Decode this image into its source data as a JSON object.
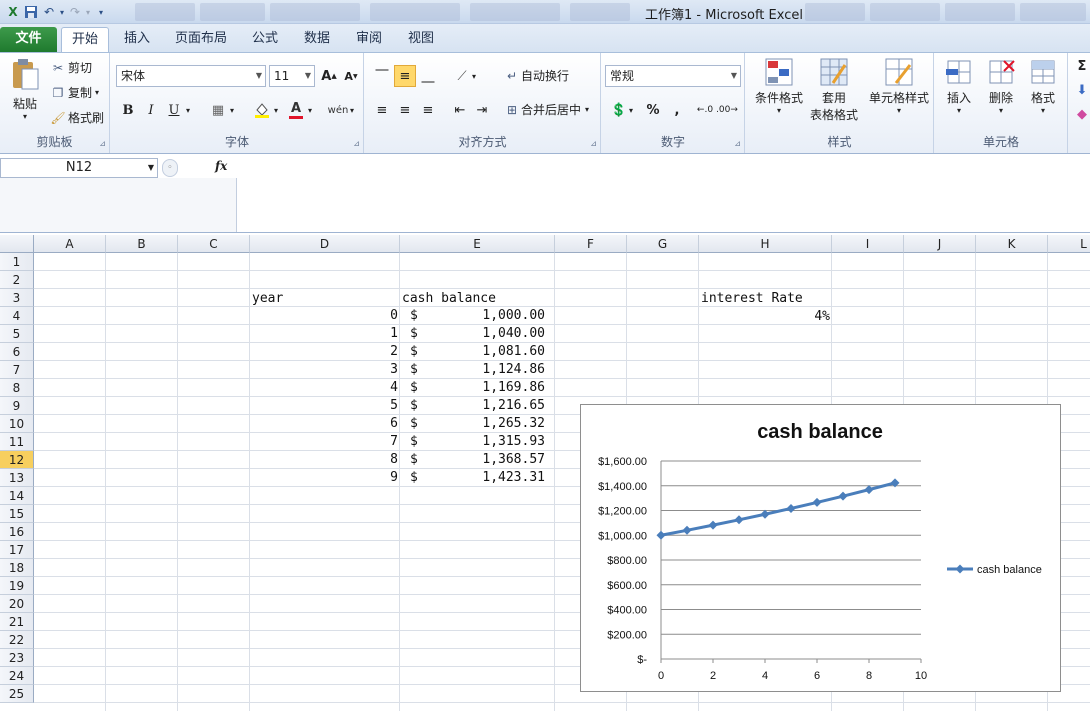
{
  "window": {
    "title": "工作簿1  -  Microsoft Excel"
  },
  "ribbon_tabs": [
    "文件",
    "开始",
    "插入",
    "页面布局",
    "公式",
    "数据",
    "审阅",
    "视图"
  ],
  "clipboard": {
    "paste": "粘贴",
    "cut": "剪切",
    "copy": "复制",
    "format_painter": "格式刷",
    "label": "剪贴板"
  },
  "font": {
    "name": "宋体",
    "size": "11",
    "bold": "B",
    "italic": "I",
    "underline": "U",
    "label": "字体"
  },
  "alignment": {
    "wrap_text": "自动换行",
    "merge_center": "合并后居中",
    "label": "对齐方式"
  },
  "number": {
    "format": "常规",
    "percent": "%",
    "comma": ",",
    "label": "数字"
  },
  "styles": {
    "conditional": "条件格式",
    "table_line1": "套用",
    "table_line2": "表格格式",
    "cell_styles": "单元格样式",
    "label": "样式"
  },
  "cells": {
    "insert": "插入",
    "delete": "删除",
    "format": "格式",
    "label": "单元格"
  },
  "formula_bar": {
    "name_box": "N12",
    "fx": "fx",
    "formula": ""
  },
  "columns": [
    "A",
    "B",
    "C",
    "D",
    "E",
    "F",
    "G",
    "H",
    "I",
    "J",
    "K",
    "L"
  ],
  "rows": [
    "1",
    "2",
    "3",
    "4",
    "5",
    "6",
    "7",
    "8",
    "9",
    "10",
    "11",
    "12",
    "13",
    "14",
    "15",
    "16",
    "17",
    "18",
    "19",
    "20",
    "21",
    "22",
    "23",
    "24",
    "25"
  ],
  "selected_row": "12",
  "sheet": {
    "year_header": "year",
    "balance_header": "cash balance",
    "rate_header": "interest Rate",
    "rate_value": "4%",
    "currency": "$",
    "years": [
      "0",
      "1",
      "2",
      "3",
      "4",
      "5",
      "6",
      "7",
      "8",
      "9"
    ],
    "balances": [
      "1,000.00",
      "1,040.00",
      "1,081.60",
      "1,124.86",
      "1,169.86",
      "1,216.65",
      "1,265.32",
      "1,315.93",
      "1,368.57",
      "1,423.31"
    ]
  },
  "colors": {
    "series": "#4a7ebb",
    "selected_row_header": "#f7cf5e",
    "file_tab": "#2a8a3a"
  },
  "chart_data": {
    "type": "scatter",
    "title": "cash balance",
    "xlabel": "",
    "ylabel": "",
    "xlim": [
      0,
      10
    ],
    "ylim": [
      0,
      1600
    ],
    "xticks": [
      "0",
      "2",
      "4",
      "6",
      "8",
      "10"
    ],
    "yticks": [
      "$-",
      "$200.00",
      "$400.00",
      "$600.00",
      "$800.00",
      "$1,000.00",
      "$1,200.00",
      "$1,400.00",
      "$1,600.00"
    ],
    "grid": "horizontal",
    "legend": "right",
    "series": [
      {
        "name": "cash balance",
        "x": [
          0,
          1,
          2,
          3,
          4,
          5,
          6,
          7,
          8,
          9
        ],
        "y": [
          1000.0,
          1040.0,
          1081.6,
          1124.86,
          1169.86,
          1216.65,
          1265.32,
          1315.93,
          1368.57,
          1423.31
        ]
      }
    ]
  }
}
